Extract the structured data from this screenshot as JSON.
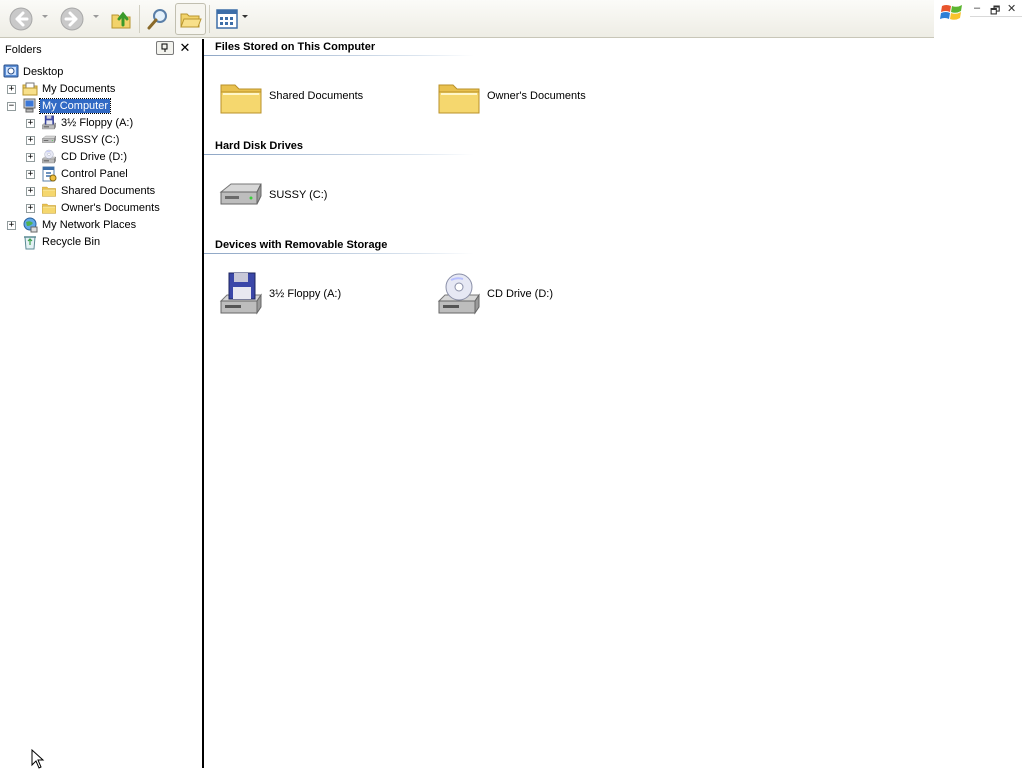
{
  "toolbar": {
    "buttons": [
      {
        "name": "back-button",
        "icon": "back-arrow-icon"
      },
      {
        "name": "forward-button",
        "icon": "forward-arrow-icon"
      },
      {
        "name": "up-button",
        "icon": "up-folder-icon"
      },
      {
        "name": "search-button",
        "icon": "search-icon"
      },
      {
        "name": "folders-button",
        "icon": "folders-icon"
      },
      {
        "name": "views-button",
        "icon": "views-icon"
      }
    ]
  },
  "window_controls": {
    "minimize": "–",
    "restore": "🗗",
    "close": "✕"
  },
  "folders_pane": {
    "title": "Folders",
    "close": "✕",
    "tree": [
      {
        "label": "Desktop",
        "icon": "desktop-icon",
        "expander": ""
      },
      {
        "label": "My Documents",
        "icon": "my-documents-icon",
        "expander": "+"
      },
      {
        "label": "My Computer",
        "icon": "my-computer-icon",
        "expander": "−",
        "selected": true
      },
      {
        "label": "3½ Floppy (A:)",
        "icon": "floppy-drive-icon",
        "expander": "+"
      },
      {
        "label": "SUSSY (C:)",
        "icon": "hard-drive-icon",
        "expander": "+"
      },
      {
        "label": "CD Drive (D:)",
        "icon": "cd-drive-icon",
        "expander": "+"
      },
      {
        "label": "Control Panel",
        "icon": "control-panel-icon",
        "expander": "+"
      },
      {
        "label": "Shared Documents",
        "icon": "folder-icon",
        "expander": "+"
      },
      {
        "label": "Owner's Documents",
        "icon": "folder-icon",
        "expander": "+"
      },
      {
        "label": "My Network Places",
        "icon": "network-places-icon",
        "expander": "+"
      },
      {
        "label": "Recycle Bin",
        "icon": "recycle-bin-icon",
        "expander": ""
      }
    ]
  },
  "content": {
    "groups": [
      {
        "title": "Files Stored on This Computer",
        "items": [
          {
            "label": "Shared Documents",
            "icon": "folder-icon"
          },
          {
            "label": "Owner's Documents",
            "icon": "folder-icon"
          }
        ]
      },
      {
        "title": "Hard Disk Drives",
        "items": [
          {
            "label": "SUSSY (C:)",
            "icon": "hard-drive-icon"
          }
        ]
      },
      {
        "title": "Devices with Removable Storage",
        "items": [
          {
            "label": "3½ Floppy (A:)",
            "icon": "floppy-drive-icon"
          },
          {
            "label": "CD Drive (D:)",
            "icon": "cd-drive-icon"
          }
        ]
      }
    ]
  },
  "colors": {
    "selection": "#316ac5",
    "group_line": "#8ea6c5",
    "folder_yellow": "#f5d76e"
  }
}
